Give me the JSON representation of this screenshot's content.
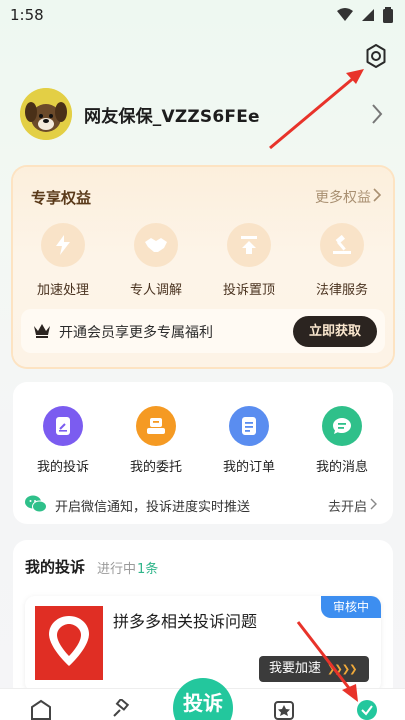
{
  "status_bar": {
    "time": "1:58"
  },
  "profile": {
    "username": "网友保保_VZZS6FEe"
  },
  "benefits": {
    "title": "专享权益",
    "more_label": "更多权益",
    "items": [
      {
        "label": "加速处理",
        "icon": "lightning-icon"
      },
      {
        "label": "专人调解",
        "icon": "handshake-icon"
      },
      {
        "label": "投诉置顶",
        "icon": "pin-top-icon"
      },
      {
        "label": "法律服务",
        "icon": "gavel-icon"
      }
    ],
    "promo_text": "开通会员享更多专属福利",
    "promo_button": "立即获取"
  },
  "services": {
    "items": [
      {
        "label": "我的投诉",
        "icon": "edit-doc-icon",
        "color": "#7b5cf0"
      },
      {
        "label": "我的委托",
        "icon": "delegate-icon",
        "color": "#f59a23"
      },
      {
        "label": "我的订单",
        "icon": "order-icon",
        "color": "#5a8df0"
      },
      {
        "label": "我的消息",
        "icon": "message-icon",
        "color": "#2fc08a"
      }
    ],
    "wechat_text": "开启微信通知，投诉进度实时推送",
    "wechat_button": "去开启"
  },
  "complaints": {
    "title": "我的投诉",
    "status_label": "进行中",
    "count": "1条",
    "item": {
      "title": "拼多多相关投诉问题",
      "badge": "审核中",
      "speed_button": "我要加速",
      "speed_arrows": "❯❯❯❯"
    }
  },
  "bottom_nav": {
    "fab_label": "投诉"
  },
  "colors": {
    "accent": "#23c79d",
    "badge_blue": "#3d8ef0",
    "arrow_red": "#e8332a",
    "pdd_red": "#e02e24"
  }
}
